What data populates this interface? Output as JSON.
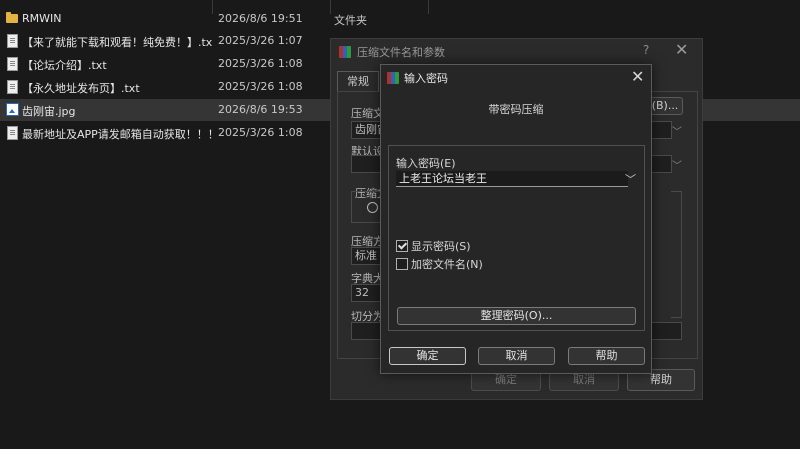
{
  "file_list": {
    "rows": [
      {
        "name": "RMWIN",
        "date": "2026/8/6 19:51",
        "type": "文件夹",
        "icon": "folder-icon"
      },
      {
        "name": "【来了就能下载和观看！纯免费！】.txt",
        "date": "2025/3/26 1:07",
        "type": "",
        "icon": "text-file-icon"
      },
      {
        "name": "【论坛介绍】.txt",
        "date": "2025/3/26 1:08",
        "type": "",
        "icon": "text-file-icon"
      },
      {
        "name": "【永久地址发布页】.txt",
        "date": "2025/3/26 1:08",
        "type": "",
        "icon": "text-file-icon"
      },
      {
        "name": "齿刚宙.jpg",
        "date": "2026/8/6 19:53",
        "type": "",
        "icon": "image-file-icon"
      },
      {
        "name": "最新地址及APP请发邮箱自动获取！！！....",
        "date": "2025/3/26 1:08",
        "type": "",
        "icon": "text-file-icon"
      }
    ]
  },
  "archive_dialog": {
    "title": "压缩文件名和参数",
    "help": "?",
    "close": "✕",
    "tab_general": "常规",
    "label_archive": "压缩文",
    "archive_value": "齿刚宙",
    "browse_label": "(B)...",
    "label_default": "默认设",
    "label_format_group": "压缩文",
    "label_method": "压缩方",
    "method_value": "标准",
    "label_dict": "字典大",
    "dict_value": "32",
    "label_split": "切分为",
    "ok": "确定",
    "cancel": "取消",
    "help_button": "帮助"
  },
  "password_dialog": {
    "title": "输入密码",
    "close": "✕",
    "heading": "带密码压缩",
    "label_enter": "输入密码(E)",
    "password_value": "上老王论坛当老王",
    "show_password": "显示密码(S)",
    "show_password_checked": true,
    "encrypt_names": "加密文件名(N)",
    "encrypt_names_checked": false,
    "organize": "整理密码(O)...",
    "ok": "确定",
    "cancel": "取消",
    "help": "帮助"
  }
}
